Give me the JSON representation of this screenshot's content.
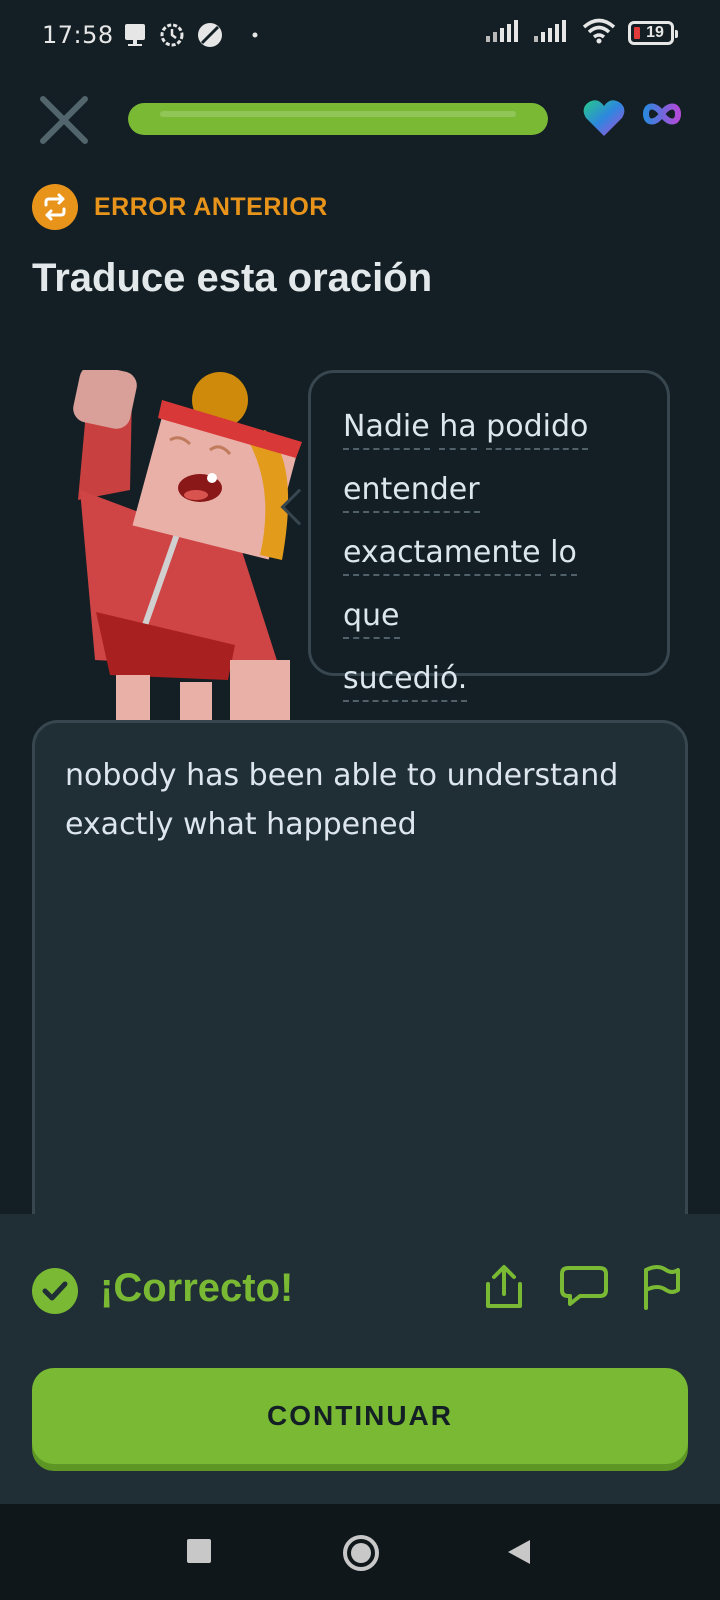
{
  "status_bar": {
    "time": "17:58",
    "battery_level": "19",
    "left_icons": [
      "notification-icon",
      "settings-sync-icon",
      "data-saver-icon",
      "dot-icon"
    ],
    "right_icons": [
      "signal-icon",
      "signal-icon",
      "wifi-icon",
      "battery-icon"
    ]
  },
  "lesson": {
    "progress_fraction": 1.0,
    "hearts": "infinite"
  },
  "tag": {
    "label": "ERROR ANTERIOR",
    "icon": "repeat-icon"
  },
  "title": "Traduce esta oración",
  "prompt": {
    "words": [
      "Nadie",
      "ha",
      "podido",
      "entender",
      "exactamente",
      "lo",
      "que",
      "sucedió."
    ]
  },
  "answer": {
    "text": "nobody has been able to understand exactly what happened"
  },
  "feedback": {
    "label": "¡Correcto!",
    "icons": [
      "share-icon",
      "comment-icon",
      "report-flag-icon"
    ]
  },
  "continue": {
    "label": "CONTINUAR"
  },
  "colors": {
    "background": "#131f24",
    "accent_green": "#79b933",
    "accent_orange": "#e8941b",
    "panel": "#202f36",
    "border": "#37464f"
  }
}
